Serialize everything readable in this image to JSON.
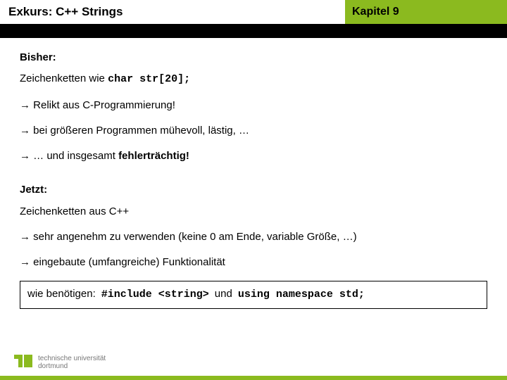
{
  "header": {
    "title_left": "Exkurs: C++ Strings",
    "title_right": "Kapitel 9"
  },
  "bisher": {
    "heading": "Bisher:",
    "line1_prefix": "Zeichenketten wie ",
    "line1_code": "char str[20];",
    "point1": "→ Relikt aus C-Programmierung!",
    "point2": "→ bei größeren Programmen mühevoll, lästig, …",
    "point3_prefix": "→ … und insgesamt ",
    "point3_bold": "fehlerträchtig!"
  },
  "jetzt": {
    "heading": "Jetzt:",
    "line1": "Zeichenketten aus C++",
    "point1": "→ sehr angenehm zu verwenden (keine 0 am Ende, variable Größe, …)",
    "point2": "→ eingebaute (umfangreiche) Funktionalität"
  },
  "req": {
    "label": "wie benötigen:",
    "code1": "#include <string>",
    "mid": "und",
    "code2": "using namespace std;"
  },
  "footer": {
    "line1": "technische universität",
    "line2": "dortmund"
  }
}
